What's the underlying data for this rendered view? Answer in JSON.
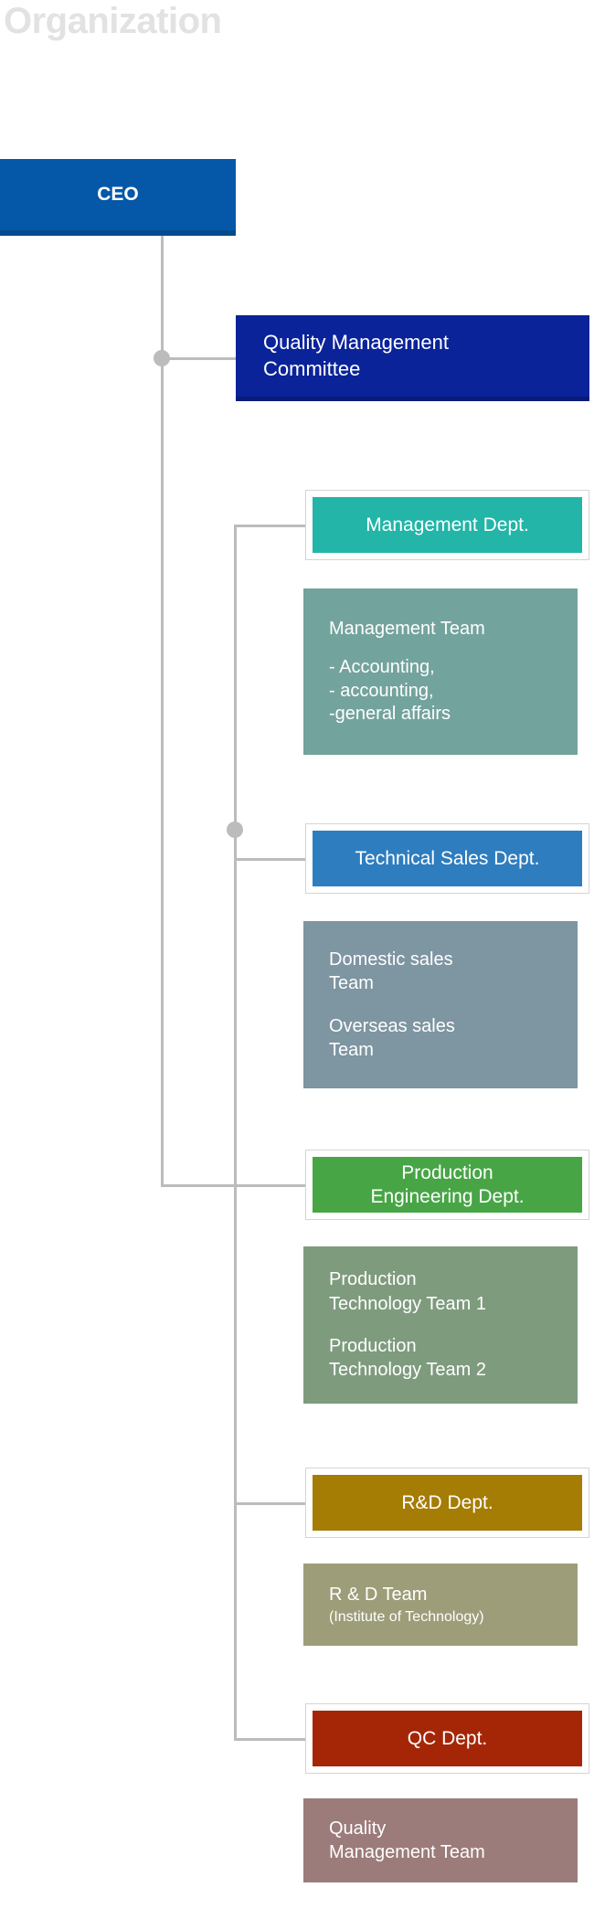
{
  "page": {
    "title": "Organization"
  },
  "colors": {
    "connector": "#bcbcbc",
    "ceo": "#0558a7",
    "quality_management_committee": "#0a2399",
    "management_dept": "#22b5a8",
    "management_team": "#73a39d",
    "technical_sales_dept": "#2e7dbf",
    "sales_teams": "#7e95a2",
    "production_engineering_dept": "#47a546",
    "production_technology_teams": "#7e9b7e",
    "rd_dept": "#a57c04",
    "rd_team": "#9d9d79",
    "qc_dept": "#a52607",
    "quality_management_team": "#9c7b7b"
  },
  "nodes": {
    "ceo": {
      "label": "CEO"
    },
    "quality_management_committee": {
      "line1": "Quality Management",
      "line2": "Committee"
    }
  },
  "departments": [
    {
      "id": "management",
      "dept_line1": "Management Dept.",
      "dept_line2": "",
      "team": {
        "heading": "Management Team",
        "items": [
          "- Accounting,",
          "- accounting,",
          " -general affairs"
        ]
      }
    },
    {
      "id": "technical-sales",
      "dept_line1": "Technical Sales Dept.",
      "dept_line2": "",
      "team": {
        "group1_line1": "Domestic sales",
        "group1_line2": "Team",
        "group2_line1": "Overseas sales",
        "group2_line2": "Team"
      }
    },
    {
      "id": "production-engineering",
      "dept_line1": "Production",
      "dept_line2": "Engineering Dept.",
      "team": {
        "group1_line1": "Production",
        "group1_line2": "Technology Team 1",
        "group2_line1": "Production",
        "group2_line2": "Technology Team 2"
      }
    },
    {
      "id": "rd",
      "dept_line1": "R&D Dept.",
      "dept_line2": "",
      "team": {
        "heading": "R & D Team",
        "subtitle": "(Institute of Technology)"
      }
    },
    {
      "id": "qc",
      "dept_line1": "QC Dept.",
      "dept_line2": "",
      "team": {
        "line1": "Quality",
        "line2": "Management Team"
      }
    }
  ]
}
